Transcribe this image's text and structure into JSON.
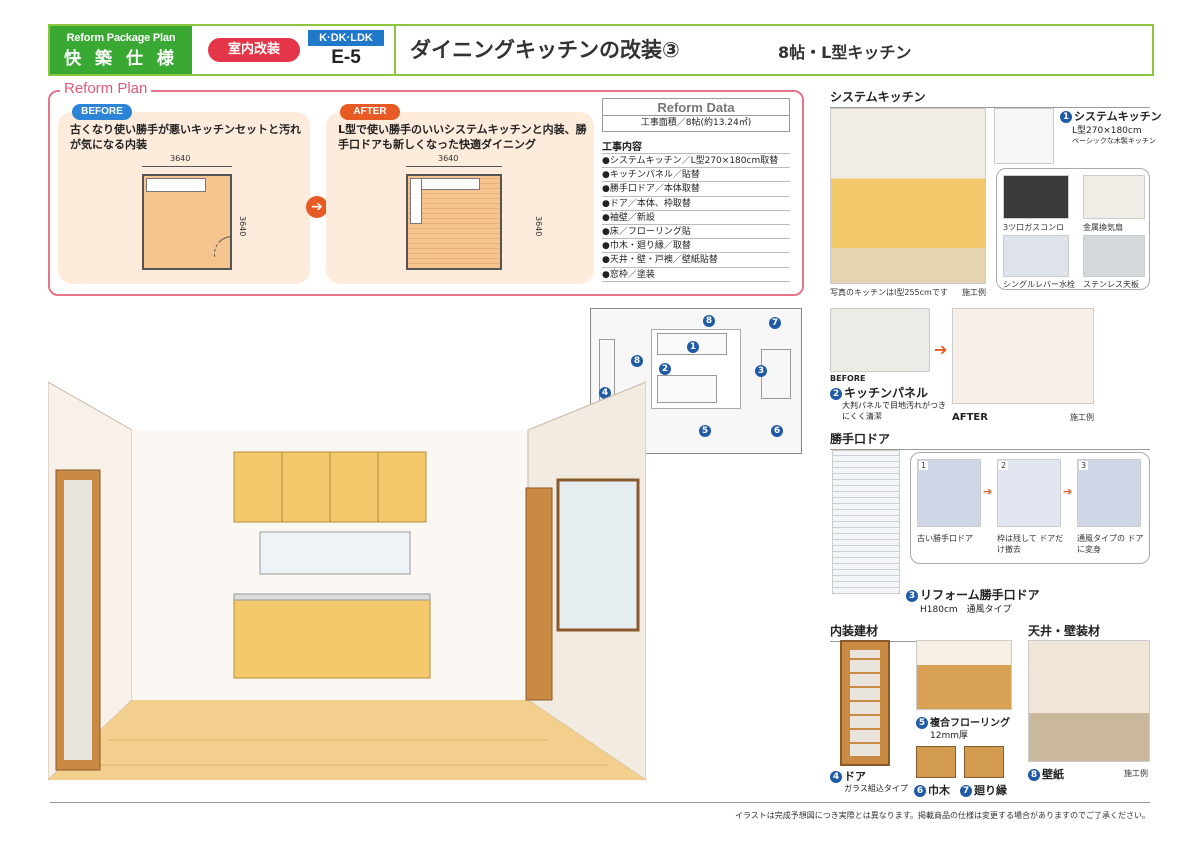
{
  "header": {
    "brand_line1": "Reform Package Plan",
    "brand_line2": "快 築 仕 様",
    "category": "室内改装",
    "room_type": "K·DK·LDK",
    "code": "E-5",
    "title": "ダイニングキッチンの改装③",
    "subtitle": "8帖・L型キッチン"
  },
  "plan": {
    "title": "Reform Plan",
    "before": {
      "label": "BEFORE",
      "text": "古くなり使い勝手が悪いキッチンセットと汚れが気になる内装",
      "width": "3640",
      "depth": "3640"
    },
    "after": {
      "label": "AFTER",
      "text": "L型で使い勝手のいいシステムキッチンと内装、勝手口ドアも新しくなった快適ダイニング",
      "width": "3640",
      "depth": "3640"
    },
    "data": {
      "heading": "Reform Data",
      "area": "工事面積／8帖(約13.24㎡)",
      "works_title": "工事内容",
      "works": [
        "●システムキッチン／L型270×180cm取替",
        "●キッチンパネル／貼替",
        "●勝手口ドア／本体取替",
        "●ドア／本体、枠取替",
        "●袖壁／新設",
        "●床／フローリング貼",
        "●巾木・廻り縁／取替",
        "●天井・壁・戸襖／壁紙貼替",
        "●窓枠／塗装"
      ]
    }
  },
  "key_numbers": [
    "8",
    "7",
    "1",
    "2",
    "3",
    "4",
    "5",
    "6",
    "8"
  ],
  "right": {
    "kitchen": {
      "heading": "システムキッチン",
      "photo_caption": "写真のキッチンはI型255cmです",
      "example": "施工例",
      "item_title": "システムキッチン",
      "item_size": "L型270×180cm",
      "item_desc": "ベーシックな木製キッチン",
      "parts": [
        "3ツ口ガスコンロ",
        "金属換気扇",
        "シングルレバー水栓",
        "ステンレス天板"
      ]
    },
    "panel": {
      "before": "BEFORE",
      "after": "AFTER",
      "title": "キッチンパネル",
      "desc": "大判パネルで目地汚れがつきにくく清潔",
      "example": "施工例"
    },
    "backdoor": {
      "heading": "勝手口ドア",
      "steps": [
        "古い勝手口ドア",
        "枠は残して ドアだけ撤去",
        "通風タイプの ドアに変身"
      ],
      "step_nums": [
        "1",
        "2",
        "3"
      ],
      "title": "リフォーム勝手口ドア",
      "spec": "H180cm　通風タイプ"
    },
    "interior": {
      "heading": "内装建材",
      "flooring": "複合フローリング",
      "flooring_spec": "12mm厚",
      "door": "ドア",
      "door_spec": "ガラス組込タイプ",
      "baseboard": "巾木",
      "molding": "廻り縁"
    },
    "ceiling": {
      "heading": "天井・壁装材",
      "wallpaper": "壁紙",
      "example": "施工例"
    }
  },
  "footnote": "イラストは完成予想図につき実際とは異なります。掲載商品の仕様は変更する場合がありますのでご了承ください。",
  "colors": {
    "green": "#3aa934",
    "red": "#e53548",
    "blue": "#1f78c8",
    "pink": "#e8748a",
    "cabinet": "#f3c96b"
  }
}
